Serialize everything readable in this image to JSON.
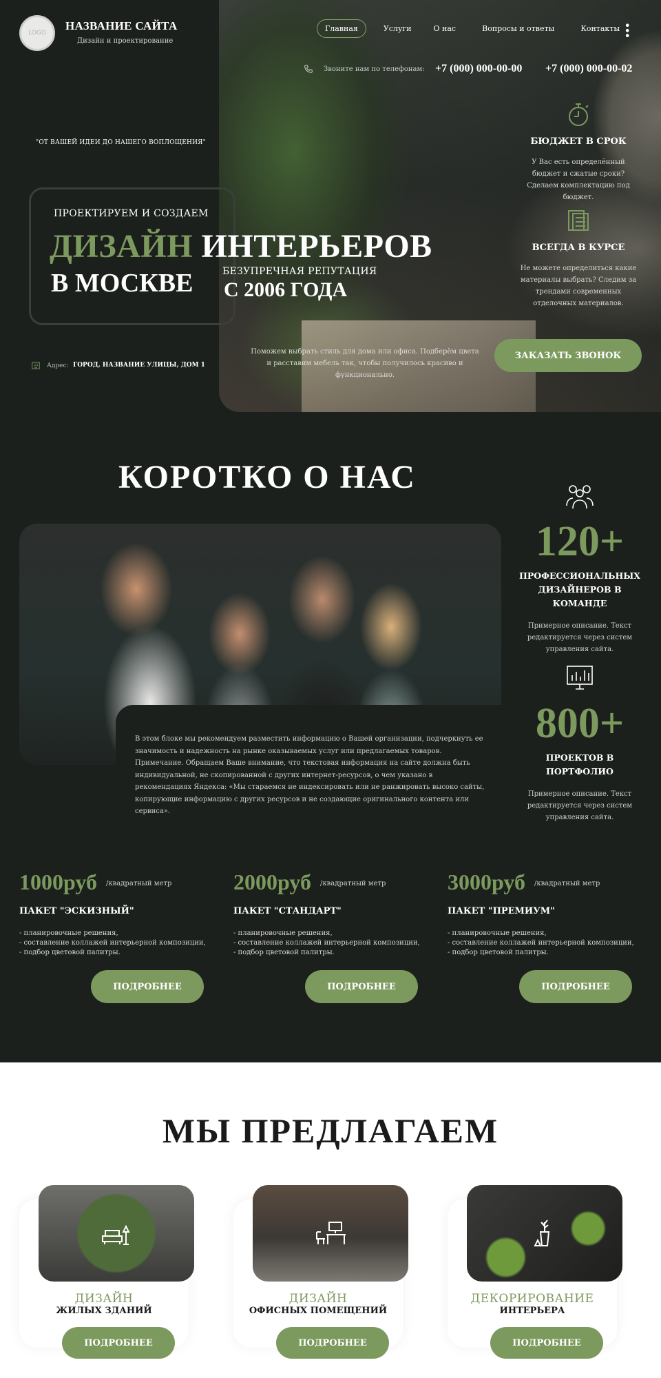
{
  "header": {
    "logo_text": "LOGO",
    "site_name": "НАЗВАНИЕ САЙТА",
    "site_sub": "Дизайн и проектирование",
    "nav": [
      "Главная",
      "Услуги",
      "О нас",
      "Вопросы и ответы",
      "Контакты"
    ],
    "phone_label": "Звоните нам по телефонам:",
    "phone1": "+7 (000) 000-00-00",
    "phone2": "+7 (000) 000-00-02"
  },
  "hero": {
    "motto": "\"ОТ ВАШЕЙ ИДЕИ ДО НАШЕГО ВОПЛОЩЕНИЯ\"",
    "pre": "ПРОЕКТИРУЕМ И СОЗДАЕМ",
    "title_accent": "ДИЗАЙН",
    "title_rest": "ИНТЕРЬЕРОВ",
    "title_line2": "В МОСКВЕ",
    "reputation": "БЕЗУПРЕЧНАЯ РЕПУТАЦИЯ",
    "since": "С 2006 ГОДА",
    "address_label": "Адрес:",
    "address": "ГОРОД, НАЗВАНИЕ УЛИЦЫ, ДОМ 1",
    "description": "Поможем выбрать стиль для дома или офиса. Подберём цвета и расставим мебель так, чтобы получилось красиво и функционально.",
    "callback": "ЗАКАЗАТЬ ЗВОНОК"
  },
  "features": [
    {
      "title": "БЮДЖЕТ В СРОК",
      "text": "У Вас есть определённый бюджет и сжатые сроки? Сделаем комплектацию под бюджет.",
      "icon": "stopwatch-icon"
    },
    {
      "title": "ВСЕГДА В КУРСЕ",
      "text": "Не можете определиться какие материалы выбрать? Следим за трендами современных отделочных материалов.",
      "icon": "swatches-icon"
    }
  ],
  "about": {
    "title": "КОРОТКО О НАС",
    "text": "В этом блоке мы рекомендуем разместить информацию о Вашей организации, подчеркнуть ее значимость и надежность на рынке оказываемых услуг или предлагаемых товаров. Примечание. Обращаем Ваше внимание, что текстовая информация на сайте должна быть индивидуальной, не скопированной с других интернет-ресурсов, о чем указано в рекомендациях Яндекса: «Мы стараемся не индексировать или не ранжировать высоко сайты, копирующие информацию с других ресурсов и не создающие оригинального контента или сервиса».",
    "stats": [
      {
        "num": "120+",
        "title": "ПРОФЕССИОНАЛЬНЫХ ДИЗАЙНЕРОВ В КОМАНДЕ",
        "text": "Примерное описание. Текст редактируется через систем управления сайта."
      },
      {
        "num": "800+",
        "title": "ПРОЕКТОВ В ПОРТФОЛИО",
        "text": "Примерное описание. Текст редактируется через систем управления сайта."
      }
    ]
  },
  "packages": [
    {
      "price": "1000руб",
      "unit": "/квадратный метр",
      "name": "ПАКЕТ \"ЭСКИЗНЫЙ\"",
      "items": [
        "- планировочные решения,",
        "- составление коллажей интерьерной композиции,",
        "- подбор цветовой палитры."
      ],
      "button": "ПОДРОБНЕЕ"
    },
    {
      "price": "2000руб",
      "unit": "/квадратный метр",
      "name": "ПАКЕТ \"СТАНДАРТ\"",
      "items": [
        "- планировочные решения,",
        "- составление коллажей интерьерной композиции,",
        "- подбор цветовой палитры."
      ],
      "button": "ПОДРОБНЕЕ"
    },
    {
      "price": "3000руб",
      "unit": "/квадратный метр",
      "name": "ПАКЕТ \"ПРЕМИУМ\"",
      "items": [
        "- планировочные решения,",
        "- составление коллажей интерьерной композиции,",
        "- подбор цветовой палитры."
      ],
      "button": "ПОДРОБНЕЕ"
    }
  ],
  "offer": {
    "title": "МЫ ПРЕДЛАГАЕМ",
    "cards": [
      {
        "t1": "ДИЗАЙН",
        "t2": "ЖИЛЫХ ЗДАНИЙ",
        "button": "ПОДРОБНЕЕ",
        "icon": "armchair-lamp-icon"
      },
      {
        "t1": "ДИЗАЙН",
        "t2": "ОФИСНЫХ ПОМЕЩЕНИЙ",
        "button": "ПОДРОБНЕЕ",
        "icon": "desk-chair-icon"
      },
      {
        "t1": "ДЕКОРИРОВАНИЕ",
        "t2": "ИНТЕРЬЕРА",
        "button": "ПОДРОБНЕЕ",
        "icon": "vase-icon"
      }
    ]
  },
  "colors": {
    "accent": "#7c9a5e",
    "background": "#1c201d",
    "offer_bg": "#ffffff"
  }
}
